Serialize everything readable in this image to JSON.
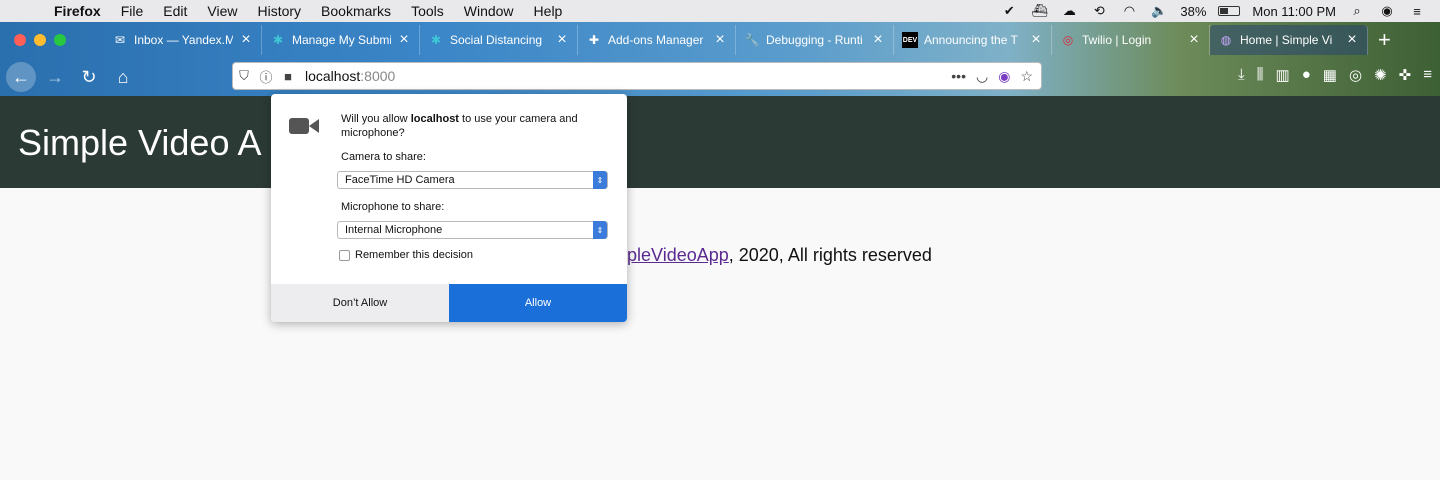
{
  "menubar": {
    "app": "Firefox",
    "items": [
      "File",
      "Edit",
      "View",
      "History",
      "Bookmarks",
      "Tools",
      "Window",
      "Help"
    ],
    "battery": "38%",
    "clock": "Mon 11:00 PM"
  },
  "tabs": [
    {
      "label": "Inbox — Yandex.M",
      "icon": "gmail-icon"
    },
    {
      "label": "Manage My Submi",
      "icon": "puzzle-icon"
    },
    {
      "label": "Social Distancing",
      "icon": "puzzle-icon"
    },
    {
      "label": "Add-ons Manager",
      "icon": "addons-icon"
    },
    {
      "label": "Debugging - Runti",
      "icon": "wrench-icon"
    },
    {
      "label": "Announcing the T",
      "icon": "dev-icon"
    },
    {
      "label": "Twilio | Login",
      "icon": "twilio-icon"
    },
    {
      "label": "Home | Simple Vi",
      "icon": "globe-icon"
    }
  ],
  "url": {
    "host": "localhost",
    "port": ":8000"
  },
  "page": {
    "title": "Simple Video A",
    "footer_link": "mpleVideoApp",
    "footer_rest": ", 2020, All rights reserved"
  },
  "popup": {
    "question_prefix": "Will you allow ",
    "question_host": "localhost",
    "question_suffix": " to use your camera and microphone?",
    "camera_label": "Camera to share:",
    "camera_value": "FaceTime HD Camera",
    "mic_label": "Microphone to share:",
    "mic_value": "Internal Microphone",
    "remember": "Remember this decision",
    "deny": "Don’t Allow",
    "allow": "Allow"
  }
}
